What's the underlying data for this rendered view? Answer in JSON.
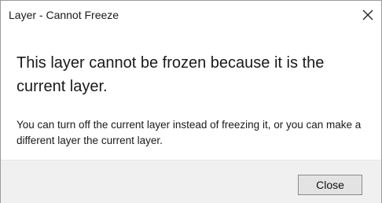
{
  "dialog": {
    "title": "Layer - Cannot Freeze",
    "headline": "This layer cannot be frozen because it is the current layer.",
    "detail": "You can turn off the current layer instead of freezing it, or you can make a different layer the current layer.",
    "close_label": "Close",
    "close_icon": "close-icon"
  },
  "colors": {
    "background": "#ffffff",
    "footer": "#f0f0f0",
    "button": "#e3e3e3",
    "text": "#1a1a1a"
  }
}
